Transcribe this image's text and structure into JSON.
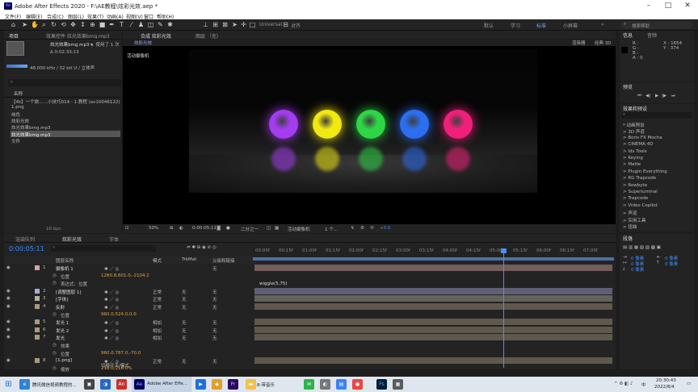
{
  "window": {
    "title": "Adobe After Effects 2020 - F:\\AE教程\\炫彩光效.aep *",
    "app_badge": "Ae"
  },
  "menu": [
    "文件(F)",
    "编辑(E)",
    "合成(C)",
    "图层(L)",
    "效果(T)",
    "动画(A)",
    "视图(V)",
    "窗口",
    "帮助(H)"
  ],
  "toolbar": {
    "snap_label": "Universal",
    "align_label": "对齐",
    "workspaces": [
      "默认",
      "学习",
      "标准",
      "小屏幕"
    ],
    "search_placeholder": "搜索帮助"
  },
  "project": {
    "tabs": [
      "项目",
      "效果控件 炫光效果bmg.mp3"
    ],
    "selected_name": "炫光效果bmg.mp3 ▾",
    "usage": "，使用了 1 次",
    "duration": "Δ 0:02:33:13",
    "audio_info": "48.000 kHz / 32 bit U / 立体声",
    "search_placeholder": "",
    "col_name": "名称",
    "items": [
      {
        "name": "【4k】一个旅……小技巧014 - 1.教程 (av10046122)"
      },
      {
        "name": "1.png"
      },
      {
        "name": "纯色"
      },
      {
        "name": "炫彩光效"
      },
      {
        "name": "炫光效果bmg.mp3"
      },
      {
        "name": "炫光效果bmg.mp3"
      },
      {
        "name": "文件"
      }
    ],
    "bpc": "16 bpc"
  },
  "composition": {
    "tabs": [
      "合成 炫彩光效",
      "图层 （无）"
    ],
    "subtab": "炫彩光效",
    "renderer_label": "渲染器",
    "renderer": "经典 3D",
    "camera_label": "活动摄像机",
    "zoom": "50%",
    "timecode": "0:00:05:11",
    "quality": "二分之一",
    "view": "活动摄像机",
    "views_count": "1 个...",
    "exposure": "+0.0",
    "ball_colors": [
      "#a43cf0",
      "#f2e812",
      "#2ed646",
      "#2c6ef0",
      "#f0207a"
    ]
  },
  "right_panel": {
    "info_tabs": [
      "信息",
      "音频"
    ],
    "info_values": [
      "R :",
      "G :",
      "B :",
      "A : 0"
    ],
    "coords": [
      "X : 1654",
      "Y : 374"
    ],
    "preview_title": "预览",
    "effects_title": "效果和预设",
    "effects_search": "",
    "effects": [
      "* 动画预设",
      "> 3D 声道",
      "> Boris FX Mocha",
      "> CINEMA 4D",
      "> Ids Tools",
      "> Keying",
      "> Matte",
      "> Plugin Everything",
      "> RG Trapcode",
      "> Rowbyte",
      "> Superluminal",
      "> Trapcode",
      "> Video Copilot",
      "> 声道",
      "> 实用工具",
      "> 扭曲"
    ],
    "align_title": "段落",
    "align_values": [
      "0 像素",
      "0 像素",
      "0 像素",
      "0 像素",
      "0 像素"
    ]
  },
  "timeline": {
    "tabs": [
      "渲染队列",
      "炫彩光效",
      "字体"
    ],
    "timecode": "0:00:05:11",
    "col_headers": [
      "图层名称",
      "模式",
      "TrkMat",
      "父级和链接"
    ],
    "ruler": [
      "00:00f",
      "00:15f",
      "01:00f",
      "01:15f",
      "02:00f",
      "02:15f",
      "03:00f",
      "03:15f",
      "04:00f",
      "04:15f",
      "05:00f",
      "05:15f",
      "06:00f",
      "06:15f",
      "07:00f"
    ],
    "expression": "wiggle(5,75)",
    "rows": [
      {
        "num": "1",
        "name": "摄像机 1",
        "mode": "",
        "parent": "无",
        "prop": "",
        "val": ""
      },
      {
        "num": "",
        "name": "位置",
        "mode": "",
        "parent": "",
        "prop": "",
        "val": "1280.8,601.0,-2104.2"
      },
      {
        "num": "",
        "name": "表达式：位置",
        "mode": "",
        "parent": "",
        "prop": "",
        "val": ""
      },
      {
        "num": "2",
        "name": "[调整图层 1]",
        "mode": "正常",
        "parent": "无",
        "prop": "",
        "val": ""
      },
      {
        "num": "3",
        "name": "[字体]",
        "mode": "正常",
        "parent": "无",
        "prop": "",
        "val": ""
      },
      {
        "num": "4",
        "name": "反射",
        "mode": "正常",
        "parent": "无",
        "prop": "",
        "val": ""
      },
      {
        "num": "",
        "name": "位置",
        "mode": "",
        "parent": "",
        "prop": "",
        "val": "960.0,524.0,0.0"
      },
      {
        "num": "5",
        "name": "发光 1",
        "mode": "相加",
        "parent": "无",
        "prop": "",
        "val": ""
      },
      {
        "num": "6",
        "name": "发光 2",
        "mode": "相加",
        "parent": "无",
        "prop": "",
        "val": ""
      },
      {
        "num": "7",
        "name": "发光",
        "mode": "相加",
        "parent": "无",
        "prop": "",
        "val": ""
      },
      {
        "num": "",
        "name": "效果",
        "mode": "",
        "parent": "",
        "prop": "",
        "val": ""
      },
      {
        "num": "",
        "name": "位置",
        "mode": "",
        "parent": "",
        "prop": "",
        "val": "960.0,787.0,-70.0"
      },
      {
        "num": "8",
        "name": "[1.png]",
        "mode": "正常",
        "parent": "无",
        "prop": "",
        "val": ""
      },
      {
        "num": "",
        "name": "缩放",
        "mode": "",
        "parent": "",
        "prop": "",
        "val": "218.0,218.0%"
      }
    ],
    "bottom_label": "切换开关/模式"
  },
  "taskbar": {
    "items": [
      "腾讯微信视频教程的...",
      "Adobe After Effe...",
      "8-带音乐"
    ],
    "time": "20:30:43",
    "date": "2022/8/4",
    "lang": "中"
  }
}
